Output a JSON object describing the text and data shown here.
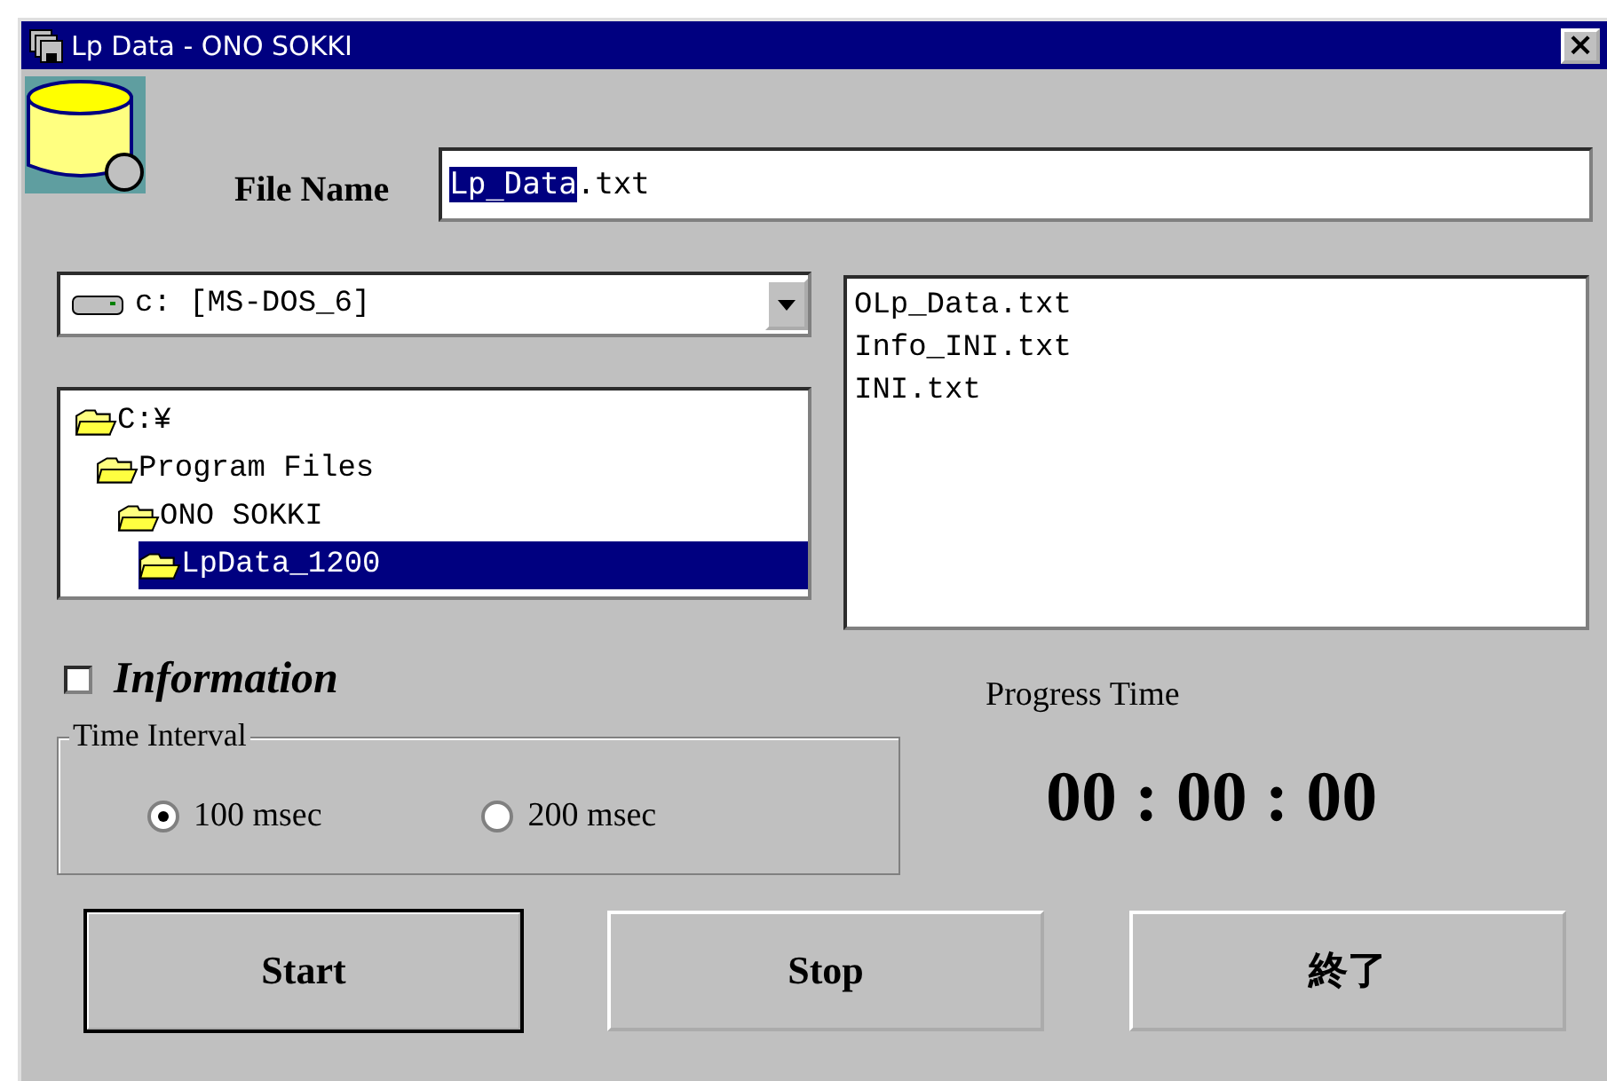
{
  "window": {
    "title": "Lp Data - ONO SOKKI",
    "close": "×"
  },
  "file_name": {
    "label": "File Name",
    "value_parts": [
      {
        "text": "Lp_Data",
        "selected": true
      },
      {
        "text": ".txt",
        "selected": false
      }
    ]
  },
  "drive": {
    "value": "c: [MS-DOS_6]"
  },
  "folders": [
    {
      "label": "C:¥",
      "selected": false,
      "children": [
        {
          "label": "Program Files",
          "selected": false,
          "children": [
            {
              "label": "ONO SOKKI",
              "selected": false,
              "children": [
                {
                  "label": "LpData_1200",
                  "selected": true
                }
              ]
            }
          ]
        }
      ]
    }
  ],
  "files": [
    {
      "label": "OLp_Data.txt",
      "selected": false
    },
    {
      "label": "Info_INI.txt",
      "selected": false
    },
    {
      "label": "INI.txt",
      "selected": false
    }
  ],
  "information": {
    "label": "Information",
    "checked": false
  },
  "time_interval": {
    "title": "Time Interval",
    "options": [
      {
        "label": "100 msec",
        "selected": true
      },
      {
        "label": "200 msec",
        "selected": false
      }
    ]
  },
  "progress": {
    "label": "Progress Time",
    "value": "00 : 00 : 00"
  },
  "buttons": [
    {
      "label": "Start",
      "default": true
    },
    {
      "label": "Stop",
      "default": false
    },
    {
      "label": "終了",
      "default": false
    }
  ]
}
